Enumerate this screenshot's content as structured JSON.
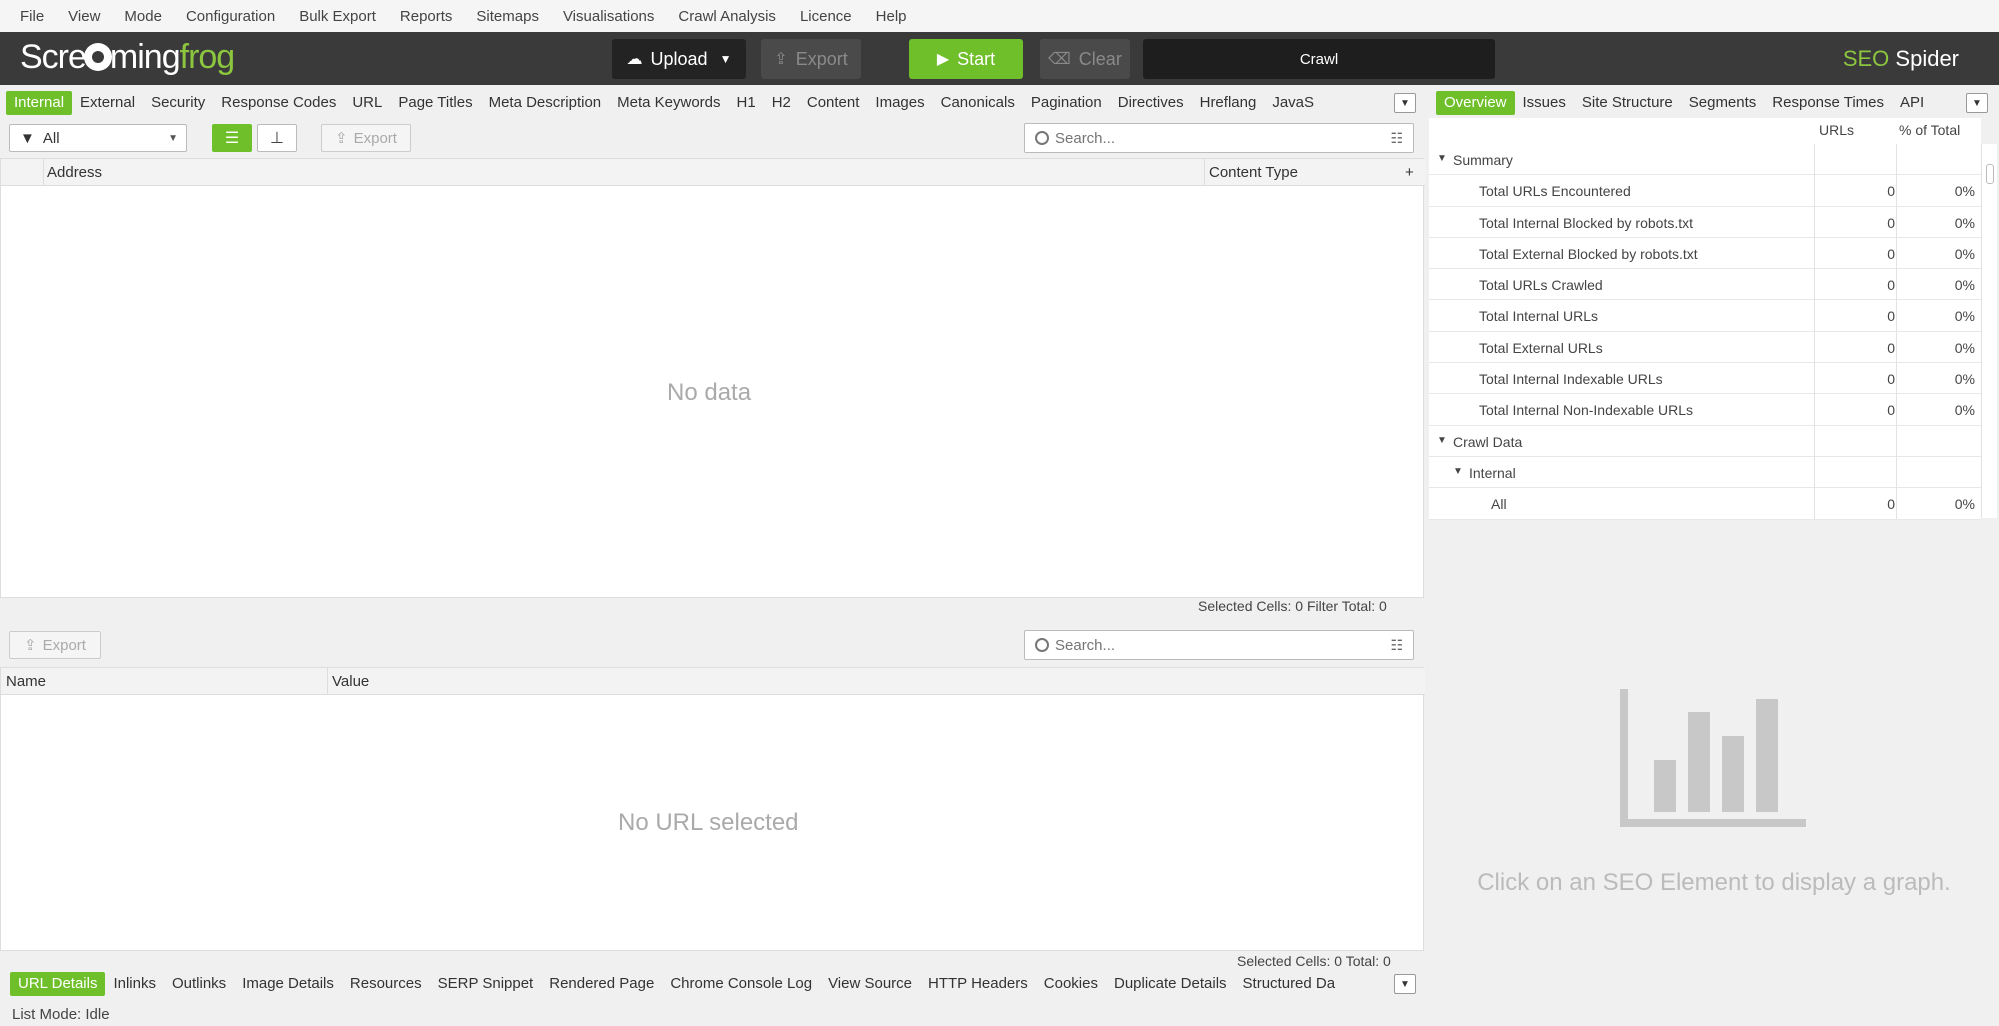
{
  "menu": [
    "File",
    "View",
    "Mode",
    "Configuration",
    "Bulk Export",
    "Reports",
    "Sitemaps",
    "Visualisations",
    "Crawl Analysis",
    "Licence",
    "Help"
  ],
  "toolbar": {
    "logo_pre": "Scre",
    "logo_post": "ming",
    "logo_frog": "frog",
    "upload": "Upload",
    "export": "Export",
    "start": "Start",
    "clear": "Clear",
    "crawl": "Crawl",
    "brand_seo": "SEO",
    "brand_spider": "Spider"
  },
  "main_tabs": [
    "Internal",
    "External",
    "Security",
    "Response Codes",
    "URL",
    "Page Titles",
    "Meta Description",
    "Meta Keywords",
    "H1",
    "H2",
    "Content",
    "Images",
    "Canonicals",
    "Pagination",
    "Directives",
    "Hreflang",
    "JavaS"
  ],
  "filter": {
    "selected": "All",
    "export": "Export",
    "search_placeholder": "Search..."
  },
  "top_table": {
    "columns": [
      "Address",
      "Content Type"
    ],
    "empty": "No data",
    "status": "Selected Cells:  0  Filter Total:  0"
  },
  "bottom_pane": {
    "export": "Export",
    "search_placeholder": "Search...",
    "columns": [
      "Name",
      "Value"
    ],
    "empty": "No URL selected",
    "status": "Selected Cells:  0  Total:  0"
  },
  "bottom_tabs": [
    "URL Details",
    "Inlinks",
    "Outlinks",
    "Image Details",
    "Resources",
    "SERP Snippet",
    "Rendered Page",
    "Chrome Console Log",
    "View Source",
    "HTTP Headers",
    "Cookies",
    "Duplicate Details",
    "Structured Da"
  ],
  "right_tabs": [
    "Overview",
    "Issues",
    "Site Structure",
    "Segments",
    "Response Times",
    "API"
  ],
  "overview": {
    "col_urls": "URLs",
    "col_pct": "% of Total",
    "rows": [
      {
        "label": "Summary",
        "urls": "",
        "pct": "",
        "level": 0,
        "group": true
      },
      {
        "label": "Total URLs Encountered",
        "urls": "0",
        "pct": "0%",
        "level": 2,
        "group": false
      },
      {
        "label": "Total Internal Blocked by robots.txt",
        "urls": "0",
        "pct": "0%",
        "level": 2,
        "group": false
      },
      {
        "label": "Total External Blocked by robots.txt",
        "urls": "0",
        "pct": "0%",
        "level": 2,
        "group": false
      },
      {
        "label": "Total URLs Crawled",
        "urls": "0",
        "pct": "0%",
        "level": 2,
        "group": false
      },
      {
        "label": "Total Internal URLs",
        "urls": "0",
        "pct": "0%",
        "level": 2,
        "group": false
      },
      {
        "label": "Total External URLs",
        "urls": "0",
        "pct": "0%",
        "level": 2,
        "group": false
      },
      {
        "label": "Total Internal Indexable URLs",
        "urls": "0",
        "pct": "0%",
        "level": 2,
        "group": false
      },
      {
        "label": "Total Internal Non-Indexable URLs",
        "urls": "0",
        "pct": "0%",
        "level": 2,
        "group": false
      },
      {
        "label": "Crawl Data",
        "urls": "",
        "pct": "",
        "level": 0,
        "group": true
      },
      {
        "label": "Internal",
        "urls": "",
        "pct": "",
        "level": 1,
        "group": true
      },
      {
        "label": "All",
        "urls": "0",
        "pct": "0%",
        "level": 3,
        "group": false
      }
    ]
  },
  "graph_message": "Click on an SEO Element to display a graph.",
  "status_bar": "List Mode: Idle",
  "colors": {
    "accent": "#6fbf2a",
    "toolbar": "#3a3a3a"
  }
}
